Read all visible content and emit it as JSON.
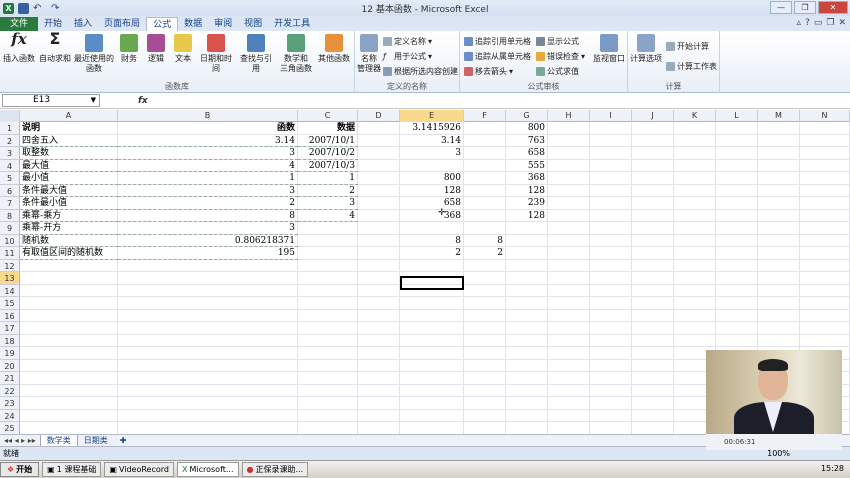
{
  "window": {
    "title": "12 基本函数 - Microsoft Excel"
  },
  "tabs": [
    "文件",
    "开始",
    "插入",
    "页面布局",
    "公式",
    "数据",
    "审阅",
    "视图",
    "开发工具"
  ],
  "active_tab": "公式",
  "ribbon": {
    "library": {
      "label": "函数库",
      "buttons": [
        {
          "l1": "插入函数",
          "l2": ""
        },
        {
          "l1": "自动求和",
          "l2": ""
        },
        {
          "l1": "最近使用的",
          "l2": "函数"
        },
        {
          "l1": "财务",
          "l2": ""
        },
        {
          "l1": "逻辑",
          "l2": ""
        },
        {
          "l1": "文本",
          "l2": ""
        },
        {
          "l1": "日期和时间",
          "l2": ""
        },
        {
          "l1": "查找与引用",
          "l2": ""
        },
        {
          "l1": "数学和",
          "l2": "三角函数"
        },
        {
          "l1": "其他函数",
          "l2": ""
        }
      ]
    },
    "names": {
      "label": "定义的名称",
      "manager_l1": "名称",
      "manager_l2": "管理器",
      "define": "定义名称",
      "use": "用于公式",
      "create": "根据所选内容创建"
    },
    "audit": {
      "label": "公式审核",
      "trace_prec": "追踪引用单元格",
      "trace_dep": "追踪从属单元格",
      "remove": "移去箭头",
      "show": "显示公式",
      "error": "错误检查",
      "eval": "公式求值",
      "watch": "监视窗口"
    },
    "calc": {
      "label": "计算",
      "options": "计算选项",
      "now": "开始计算",
      "sheet": "计算工作表"
    }
  },
  "formula_bar": {
    "name_box": "E13",
    "fx": "fx"
  },
  "columns": [
    "A",
    "B",
    "C",
    "D",
    "E",
    "F",
    "G",
    "H",
    "I",
    "J",
    "K",
    "L",
    "M",
    "N"
  ],
  "rows": [
    "1",
    "2",
    "3",
    "4",
    "5",
    "6",
    "7",
    "8",
    "9",
    "10",
    "11",
    "12",
    "13",
    "14",
    "15",
    "16",
    "17",
    "18",
    "19",
    "20",
    "21",
    "22",
    "23",
    "24",
    "25"
  ],
  "cells": {
    "A": [
      "说明",
      "四舍五入",
      "取整数",
      "最大值",
      "最小值",
      "条件最大值",
      "条件最小值",
      "乘幂-乘方",
      "乘幂-开方",
      "随机数",
      "有取值区间的随机数"
    ],
    "B": [
      "函数",
      "3.14",
      "3",
      "4",
      "1",
      "3",
      "2",
      "8",
      "3",
      "0.806218371",
      "195"
    ],
    "C": [
      "数据",
      "2007/10/1",
      "2007/10/2",
      "2007/10/3",
      "1",
      "2",
      "3",
      "4",
      "",
      "",
      ""
    ],
    "E": [
      "3.1415926",
      "3.14",
      "3",
      "",
      "800",
      "128",
      "658",
      "368",
      "",
      "8",
      "2"
    ],
    "F": [
      "",
      "",
      "",
      "",
      "",
      "",
      "",
      "",
      "",
      "8",
      "2"
    ],
    "G": [
      "800",
      "763",
      "658",
      "555",
      "368",
      "128",
      "239",
      "128",
      "",
      "",
      ""
    ]
  },
  "sheets": [
    "数学类",
    "日期类"
  ],
  "status": {
    "ready": "就绪",
    "zoom": "100%"
  },
  "taskbar": {
    "start": "开始",
    "items": [
      "1 课程基础",
      "VideoRecord",
      "Microsoft...",
      "正保录课助..."
    ],
    "clock": "15:28"
  },
  "video": {
    "time": "00:06:31"
  }
}
